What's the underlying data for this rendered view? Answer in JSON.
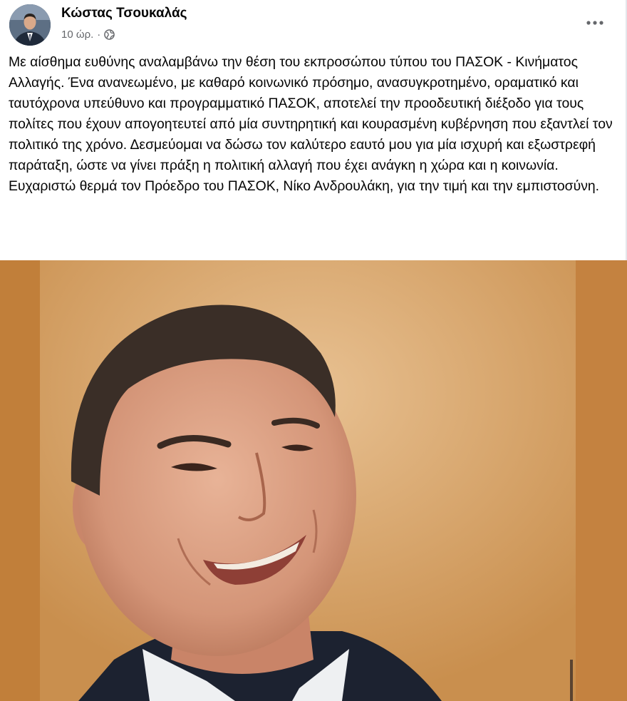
{
  "post": {
    "author_name": "Κώστας Τσουκαλάς",
    "time": "10 ώρ.",
    "separator": "·",
    "privacy_icon": "globe-icon",
    "more_icon": "more-options-icon",
    "text": "Με αίσθημα ευθύνης αναλαμβάνω την θέση του εκπροσώπου τύπου του ΠΑΣΟΚ - Κινήματος Αλλαγής. Ένα ανανεωμένο, με καθαρό κοινωνικό πρόσημο, ανασυγκροτημένο, οραματικό και ταυτόχρονα υπεύθυνο και προγραμματικό ΠΑΣΟΚ, αποτελεί την προοδευτική διέξοδο για τους πολίτες που έχουν απογοητευτεί από μία συντηρητική και κουρασμένη κυβέρνηση που εξαντλεί τον πολιτικό της χρόνο. Δεσμεύομαι να δώσω τον καλύτερο εαυτό μου για μία ισχυρή και εξωστρεφή παράταξη, ώστε να γίνει πράξη η πολιτική αλλαγή που έχει ανάγκη η χώρα και η κοινωνία. Ευχαριστώ θερμά τον Πρόεδρο του ΠΑΣΟΚ, Νίκο Ανδρουλάκη, για την τιμή και την εμπιστοσύνη."
  },
  "colors": {
    "text_primary": "#050505",
    "text_secondary": "#65676b",
    "photo_background": "#c88a3e"
  }
}
